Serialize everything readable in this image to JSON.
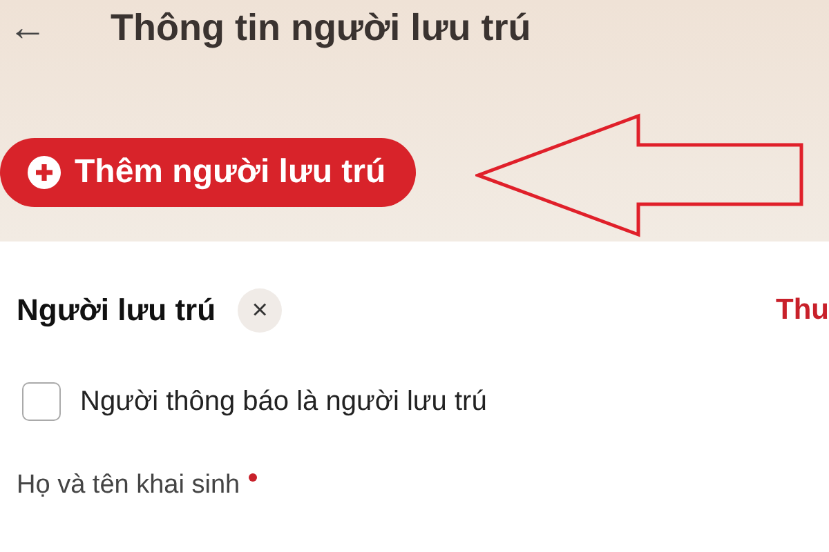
{
  "header": {
    "back": "←",
    "title": "Thông tin người lưu trú"
  },
  "add_button": {
    "label": "Thêm người lưu trú"
  },
  "section": {
    "title": "Người lưu trú",
    "close": "×",
    "action": "Thu"
  },
  "checkbox": {
    "label": "Người thông báo là người lưu trú",
    "checked": false
  },
  "field": {
    "label": "Họ và tên khai sinh",
    "required": true
  }
}
